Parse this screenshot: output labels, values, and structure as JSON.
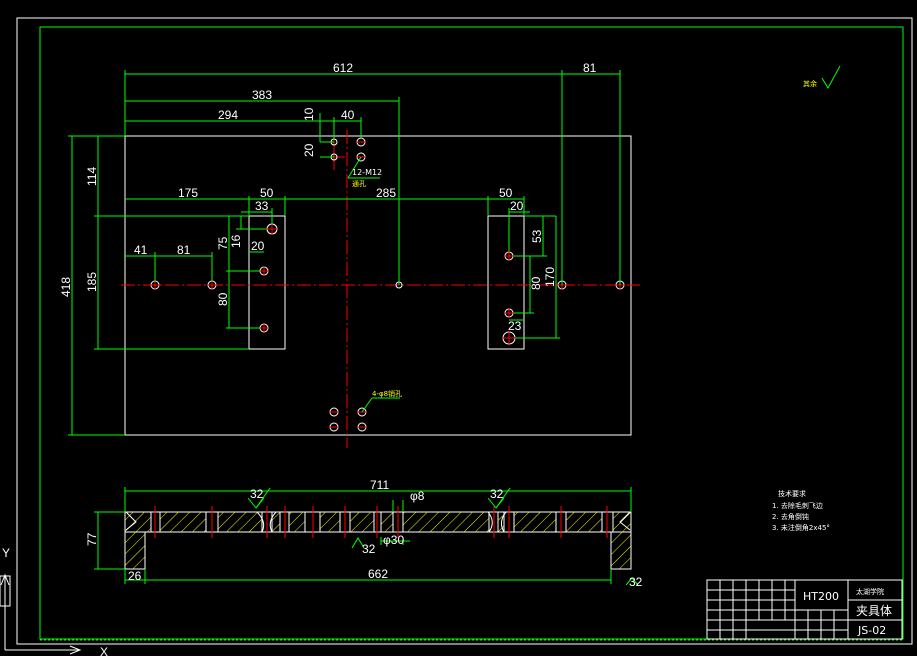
{
  "drawing": {
    "background": "#000000",
    "colors": {
      "border": "#00ff00",
      "outline": "#ffffff",
      "dimension": "#00ff00",
      "centerline": "#ff0000",
      "hatch": "#ffff00",
      "text": "#ffffff",
      "hole": "#ff3333"
    },
    "top_view": {
      "dimensions": {
        "d612": "612",
        "d81_top": "81",
        "d383": "383",
        "d294": "294",
        "d10": "10",
        "d40": "40",
        "d20": "20",
        "d114": "114",
        "d418": "418",
        "d175": "175",
        "d50_left": "50",
        "d33": "33",
        "d285": "285",
        "d50_right": "50",
        "d20_right": "20",
        "d75": "75",
        "d16": "16",
        "d20_left": "20",
        "d41": "41",
        "d81_mid": "81",
        "d185": "185",
        "d80_left": "80",
        "d53": "53",
        "d170": "170",
        "d80_right": "80",
        "d23": "23"
      },
      "notes": {
        "tapped_holes": "12-M12",
        "tapped_sub": "通孔",
        "pin_holes": "4-φ8销孔"
      }
    },
    "section_view": {
      "dimensions": {
        "d711": "711",
        "d_phi8": "φ8",
        "d_r32": "32",
        "d77": "77",
        "d26": "26",
        "d662": "662",
        "d_phi30": "φ30",
        "d_sq32_left": "32",
        "d_sq32_right": "32",
        "d32_mid": "32"
      }
    },
    "surface_mark": "其余",
    "tech_requirements": {
      "title": "技术要求",
      "items": [
        "1. 去除毛刺飞边",
        "2. 去角倒钝",
        "3. 未注倒角2x45°"
      ]
    },
    "title_block": {
      "material": "HT200",
      "school": "太湖学院",
      "part_name": "夹具体",
      "drawing_no": "JS-02"
    },
    "ucs": {
      "x_label": "X",
      "y_label": "Y"
    }
  }
}
